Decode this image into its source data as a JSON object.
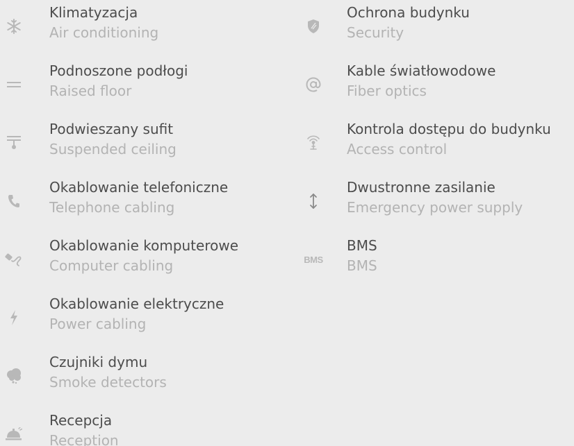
{
  "amenities_left": [
    {
      "label_pl": "Klimatyzacja",
      "label_en": "Air conditioning",
      "icon": "snowflake-icon"
    },
    {
      "label_pl": "Podnoszone podłogi",
      "label_en": "Raised floor",
      "icon": "raised-floor-icon"
    },
    {
      "label_pl": "Podwieszany sufit",
      "label_en": "Suspended ceiling",
      "icon": "suspended-ceiling-icon"
    },
    {
      "label_pl": "Okablowanie telefoniczne",
      "label_en": "Telephone cabling",
      "icon": "telephone-icon"
    },
    {
      "label_pl": "Okablowanie komputerowe",
      "label_en": "Computer cabling",
      "icon": "computer-cable-icon"
    },
    {
      "label_pl": "Okablowanie elektryczne",
      "label_en": "Power cabling",
      "icon": "lightning-icon"
    },
    {
      "label_pl": "Czujniki dymu",
      "label_en": "Smoke detectors",
      "icon": "smoke-detector-icon"
    },
    {
      "label_pl": "Recepcja",
      "label_en": "Reception",
      "icon": "reception-bell-icon"
    }
  ],
  "amenities_right": [
    {
      "label_pl": "Ochrona budynku",
      "label_en": "Security",
      "icon": "shield-icon"
    },
    {
      "label_pl": "Kable światłowodowe",
      "label_en": "Fiber optics",
      "icon": "at-sign-icon"
    },
    {
      "label_pl": "Kontrola dostępu do budynku",
      "label_en": "Access control",
      "icon": "antenna-icon"
    },
    {
      "label_pl": "Dwustronne zasilanie",
      "label_en": "Emergency power supply",
      "icon": "double-arrow-icon"
    },
    {
      "label_pl": "BMS",
      "label_en": "BMS",
      "icon": "bms-icon",
      "icon_text": "BMS"
    }
  ],
  "colors": {
    "background": "#ececec",
    "primary_text": "#4c4c4c",
    "secondary_text": "#b3b3b3",
    "icon": "#b8b8b8"
  }
}
